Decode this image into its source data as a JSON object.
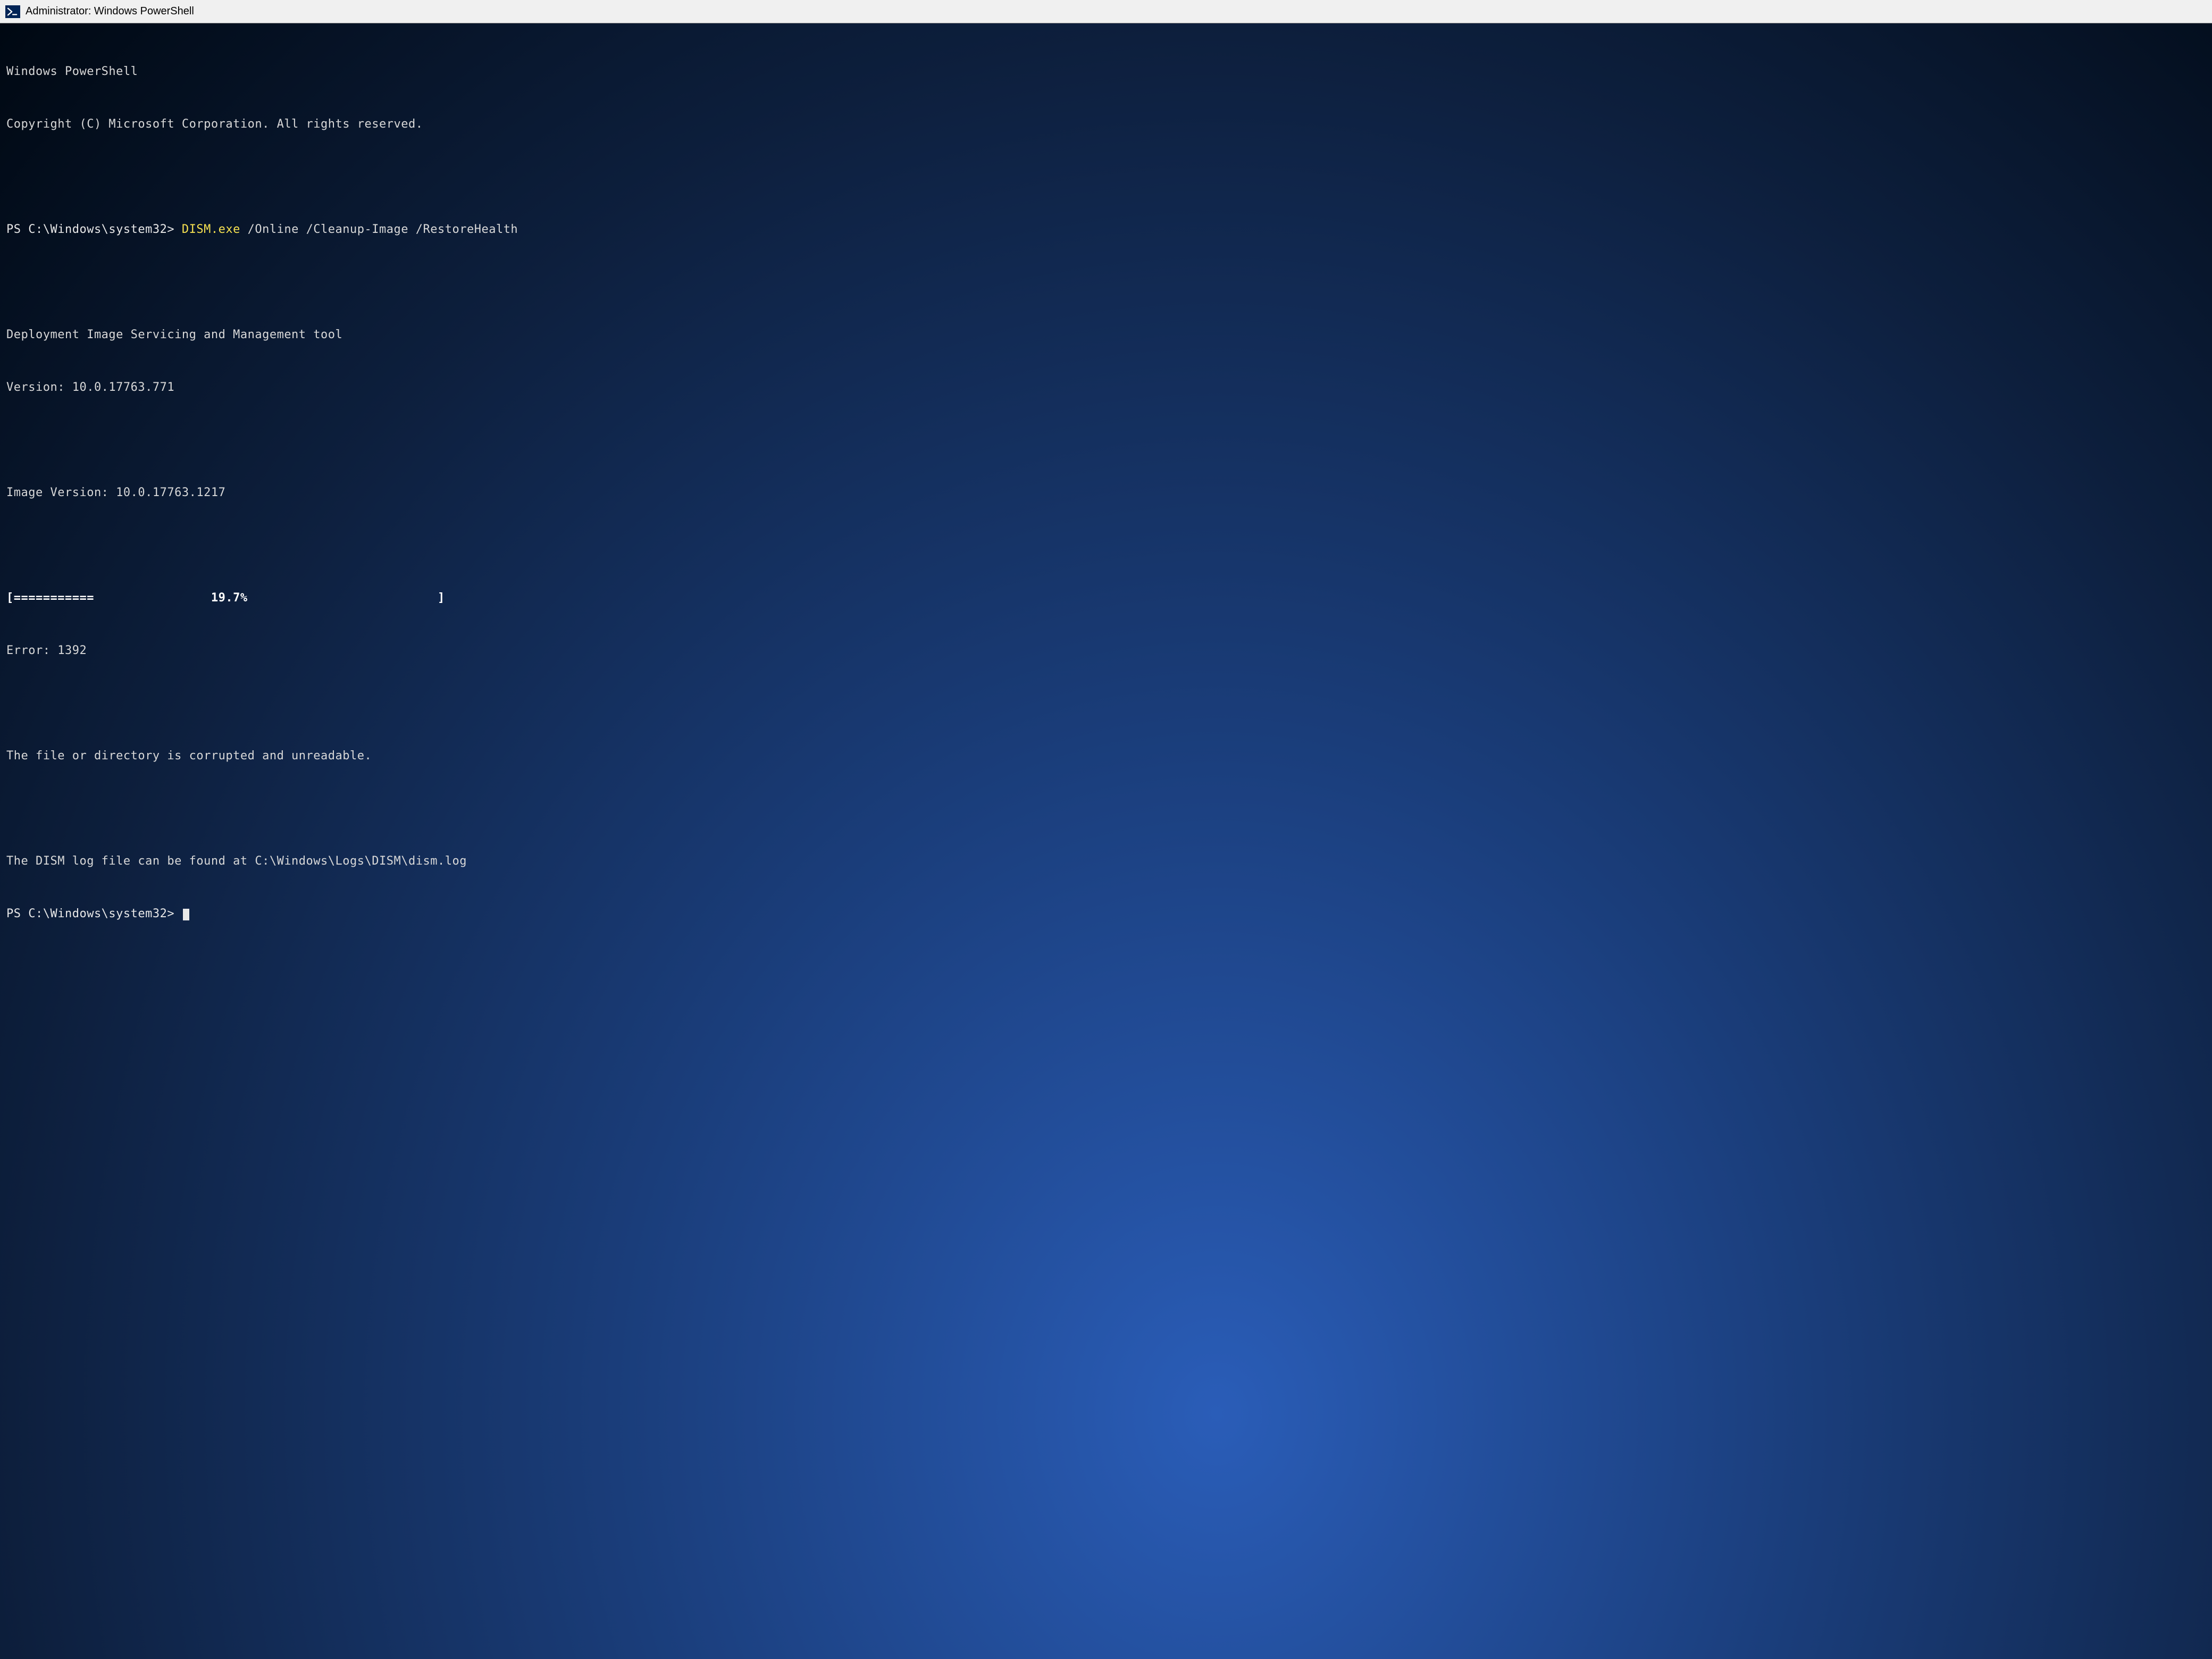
{
  "window": {
    "title": "Administrator: Windows PowerShell"
  },
  "terminal": {
    "header1": "Windows PowerShell",
    "header2": "Copyright (C) Microsoft Corporation. All rights reserved.",
    "prompt1": "PS C:\\Windows\\system32> ",
    "cmd_exe": "DISM.exe",
    "cmd_args": " /Online /Cleanup-Image /RestoreHealth",
    "tool_name": "Deployment Image Servicing and Management tool",
    "tool_version": "Version: 10.0.17763.771",
    "image_version": "Image Version: 10.0.17763.1217",
    "progress": "[===========                19.7%                          ]",
    "error_code": "Error: 1392",
    "error_msg": "The file or directory is corrupted and unreadable.",
    "log_msg": "The DISM log file can be found at C:\\Windows\\Logs\\DISM\\dism.log",
    "prompt2": "PS C:\\Windows\\system32> "
  }
}
